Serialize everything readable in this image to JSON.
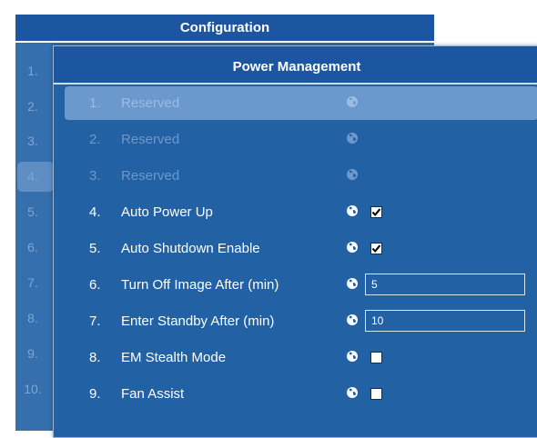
{
  "config": {
    "title": "Configuration",
    "row_numbers": [
      "1.",
      "2.",
      "3.",
      "4.",
      "5.",
      "6.",
      "7.",
      "8.",
      "9.",
      "10."
    ]
  },
  "power_management": {
    "title": "Power Management",
    "items": [
      {
        "number": "1.",
        "label": "Reserved",
        "control": "none",
        "state": "disabled-selected"
      },
      {
        "number": "2.",
        "label": "Reserved",
        "control": "none",
        "state": "disabled"
      },
      {
        "number": "3.",
        "label": "Reserved",
        "control": "none",
        "state": "disabled"
      },
      {
        "number": "4.",
        "label": "Auto Power Up",
        "control": "checkbox",
        "checked": true
      },
      {
        "number": "5.",
        "label": "Auto Shutdown Enable",
        "control": "checkbox",
        "checked": true
      },
      {
        "number": "6.",
        "label": "Turn Off Image After (min)",
        "control": "text",
        "value": "5"
      },
      {
        "number": "7.",
        "label": "Enter Standby After (min)",
        "control": "text",
        "value": "10"
      },
      {
        "number": "8.",
        "label": "EM Stealth Mode",
        "control": "checkbox",
        "checked": false
      },
      {
        "number": "9.",
        "label": "Fan Assist",
        "control": "checkbox",
        "checked": false
      }
    ]
  },
  "icons": {
    "globe": "globe-icon",
    "checkmark": "checkmark-icon"
  },
  "colors": {
    "title_bar": "#1c56a0",
    "dialog_bg": "#2361a5",
    "selected_row": "#6b98cd",
    "disabled_text": "#6f98c8"
  }
}
